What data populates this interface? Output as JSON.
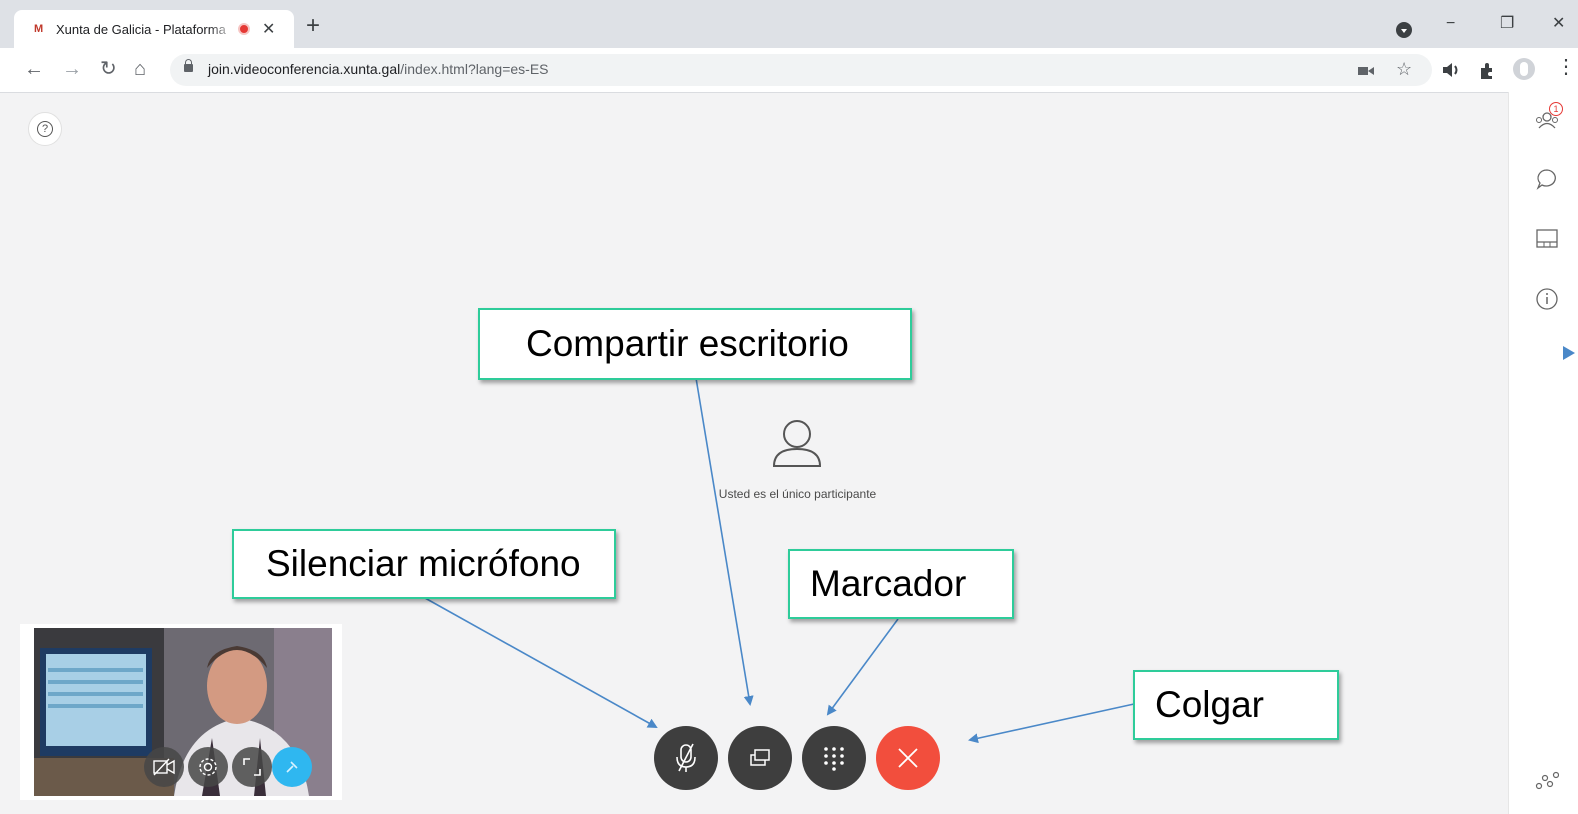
{
  "browser": {
    "tab_title": "Xunta de Galicia - Plataforma",
    "tab_close": "✕",
    "new_tab": "+",
    "url_host": "join.videoconferencia.xunta.gal",
    "url_path": "/index.html?lang=es-ES",
    "window_controls": {
      "minimize": "−",
      "restore": "❐",
      "close": "✕"
    },
    "toolbar_icons": [
      "camera-icon",
      "star-icon",
      "speaker-icon",
      "extensions-icon",
      "profile-icon",
      "menu-icon"
    ]
  },
  "app": {
    "help_label": "?",
    "participants_badge": "1",
    "empty_state_text": "Usted es el único participante",
    "sidebar_icons": [
      "participants-icon",
      "chat-icon",
      "layout-icon",
      "info-icon",
      "stats-icon"
    ],
    "controls": [
      "mute-mic-button",
      "share-screen-button",
      "dialpad-button",
      "hang-up-button"
    ],
    "colors": {
      "hang_up": "#f24e3d",
      "control_dark": "#3e3e3e",
      "callout_border": "#2ecc9a",
      "arrow": "#4a88c8",
      "pip_active": "#2fb7f0"
    }
  },
  "callouts": {
    "share": "Compartir escritorio",
    "mute": "Silenciar micrófono",
    "dialpad": "Marcador",
    "hangup": "Colgar"
  }
}
